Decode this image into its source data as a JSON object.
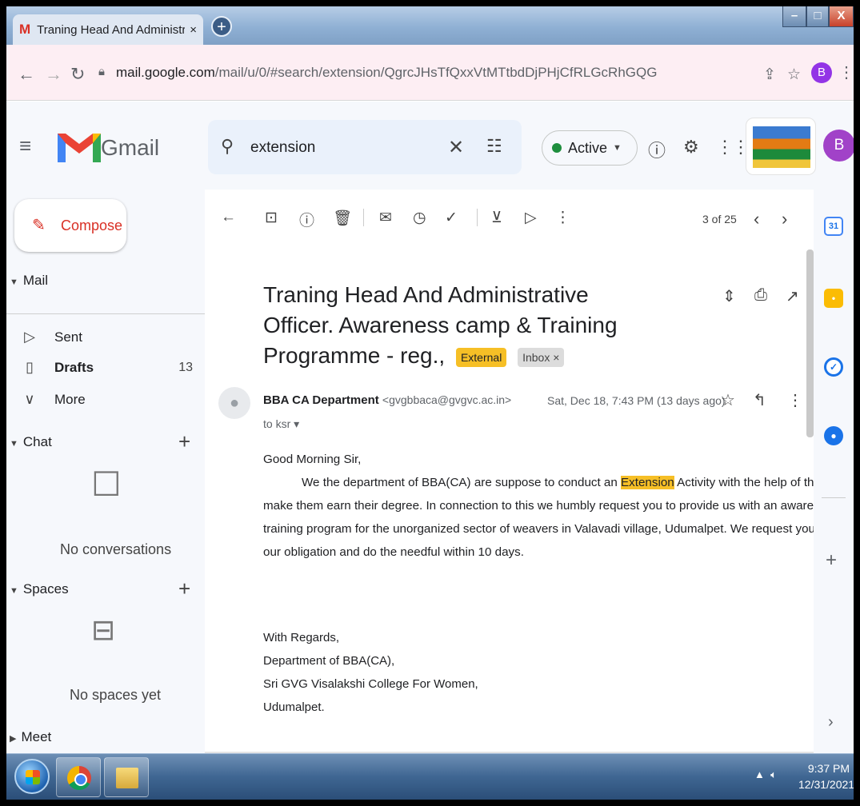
{
  "browser": {
    "tab_title": "Traning Head And Administrative",
    "tab_close": "×",
    "new_tab": "+",
    "url_host": "mail.google.com",
    "url_path": "/mail/u/0/#search/extension/QgrcJHsTfQxxVtMTtbdDjPHjCfRLGcRhGQG",
    "profile_letter": "B",
    "window_controls": {
      "minimize": "–",
      "maximize": "□",
      "close": "X"
    }
  },
  "gmail": {
    "app_name": "Gmail",
    "search": {
      "query": "extension"
    },
    "status": {
      "label": "Active",
      "color": "#1e8e3e"
    },
    "account_letter": "B"
  },
  "sidebar": {
    "compose_label": "Compose",
    "mail_section": "Mail",
    "items": [
      {
        "label": "Sent",
        "icon": "send-icon"
      },
      {
        "label": "Drafts",
        "icon": "draft-icon",
        "count": "13"
      },
      {
        "label": "More",
        "icon": "chevron-down-icon"
      }
    ],
    "chat_section": "Chat",
    "chat_empty": "No conversations",
    "spaces_section": "Spaces",
    "spaces_empty": "No spaces yet",
    "meet_section": "Meet"
  },
  "toolbar": {
    "pager": "3 of 25"
  },
  "message": {
    "subject": "Traning Head And Administrative Officer. Awareness camp & Training Programme - reg.,",
    "labels": {
      "external": "External",
      "inbox": "Inbox ×"
    },
    "sender_name": "BBA CA Department",
    "sender_email": "<gvgbbaca@gvgvc.ac.in>",
    "recipient": "to ksr ▾",
    "date": "Sat, Dec 18, 7:43 PM (13 days ago)",
    "greeting": "Good Morning Sir,",
    "body_line1_pre": "We the department of BBA(CA) are suppose to conduct  an ",
    "body_highlight": "Extension",
    "body_line1_post": " Activity with the help of the students to",
    "body_line2": "make them earn their degree. In connection to this we humbly request you to provide us with an awareness camp and",
    "body_line3": "training program for the unorganized sector of  weavers in Valavadi village, Udumalpet. We request you to consider",
    "body_line4": "our obligation and do the needful within 10 days.",
    "signature": [
      "With Regards,",
      " Department of BBA(CA),",
      " Sri GVG Visalakshi College For Women,",
      " Udumalpet."
    ]
  },
  "sidepanel": {
    "calendar_day": "31"
  },
  "taskbar": {
    "time": "9:37 PM",
    "date": "12/31/2021"
  },
  "colors": {
    "accent_red": "#d93025",
    "label_external": "#f6bf26",
    "avatar_purple": "#a142c8"
  }
}
